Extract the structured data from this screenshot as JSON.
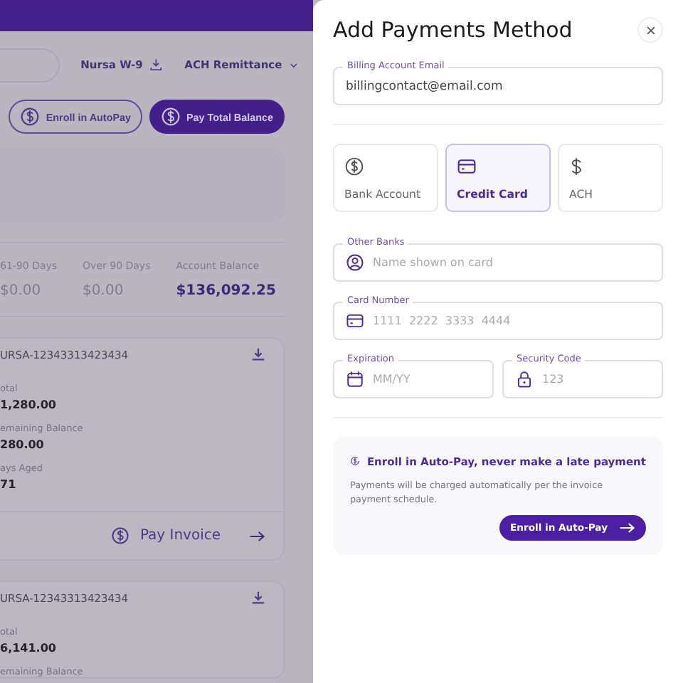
{
  "page": {
    "links": [
      {
        "label": "Nursa W-9",
        "kind": "download"
      },
      {
        "label": "ACH Remittance",
        "kind": "dropdown"
      }
    ],
    "buttons": [
      {
        "label": "Enroll in AutoPay",
        "kind": "outline"
      },
      {
        "label": "Pay Total Balance",
        "kind": "filled"
      }
    ],
    "summary": [
      {
        "label": "61-90 Days",
        "value": "$0.00",
        "highlight": false
      },
      {
        "label": "Over 90 Days",
        "value": "$0.00",
        "highlight": false
      },
      {
        "label": "Account Balance",
        "value": "$136,092.25",
        "highlight": true
      }
    ],
    "invoices": [
      {
        "number": "URSA-12343313423434",
        "fields": [
          {
            "label": "otal",
            "value": "1,280.00"
          },
          {
            "label": "emaining Balance",
            "value": "280.00"
          },
          {
            "label": "ays Aged",
            "value": "71"
          }
        ],
        "action": "Pay Invoice"
      },
      {
        "number": "URSA-12343313423434",
        "fields": [
          {
            "label": "otal",
            "value": "6,141.00"
          },
          {
            "label": "emaining Balance"
          }
        ]
      }
    ]
  },
  "drawer": {
    "title": "Add Payments Method",
    "email": {
      "label": "Billing Account Email",
      "value": "billingcontact@email.com"
    },
    "methods": [
      {
        "label": "Bank Account",
        "kind": "bank",
        "selected": false
      },
      {
        "label": "Credit Card",
        "kind": "card",
        "selected": true
      },
      {
        "label": "ACH",
        "kind": "ach",
        "selected": false
      }
    ],
    "fields": [
      {
        "label": "Other Banks",
        "placeholder": "Name shown on card",
        "kind": "person"
      },
      {
        "label": "Card Number",
        "placeholder": "1111  2222  3333  4444",
        "kind": "card"
      }
    ],
    "half_fields": [
      {
        "label": "Expiration",
        "placeholder": "MM/YY",
        "kind": "calendar"
      },
      {
        "label": "Security Code",
        "placeholder": "123",
        "kind": "lock"
      }
    ],
    "autopay": {
      "title": "Enroll in Auto-Pay, never make a late payment",
      "text": "Payments will be charged automatically per the invoice payment schedule.",
      "button": "Enroll in Auto-Pay"
    }
  }
}
